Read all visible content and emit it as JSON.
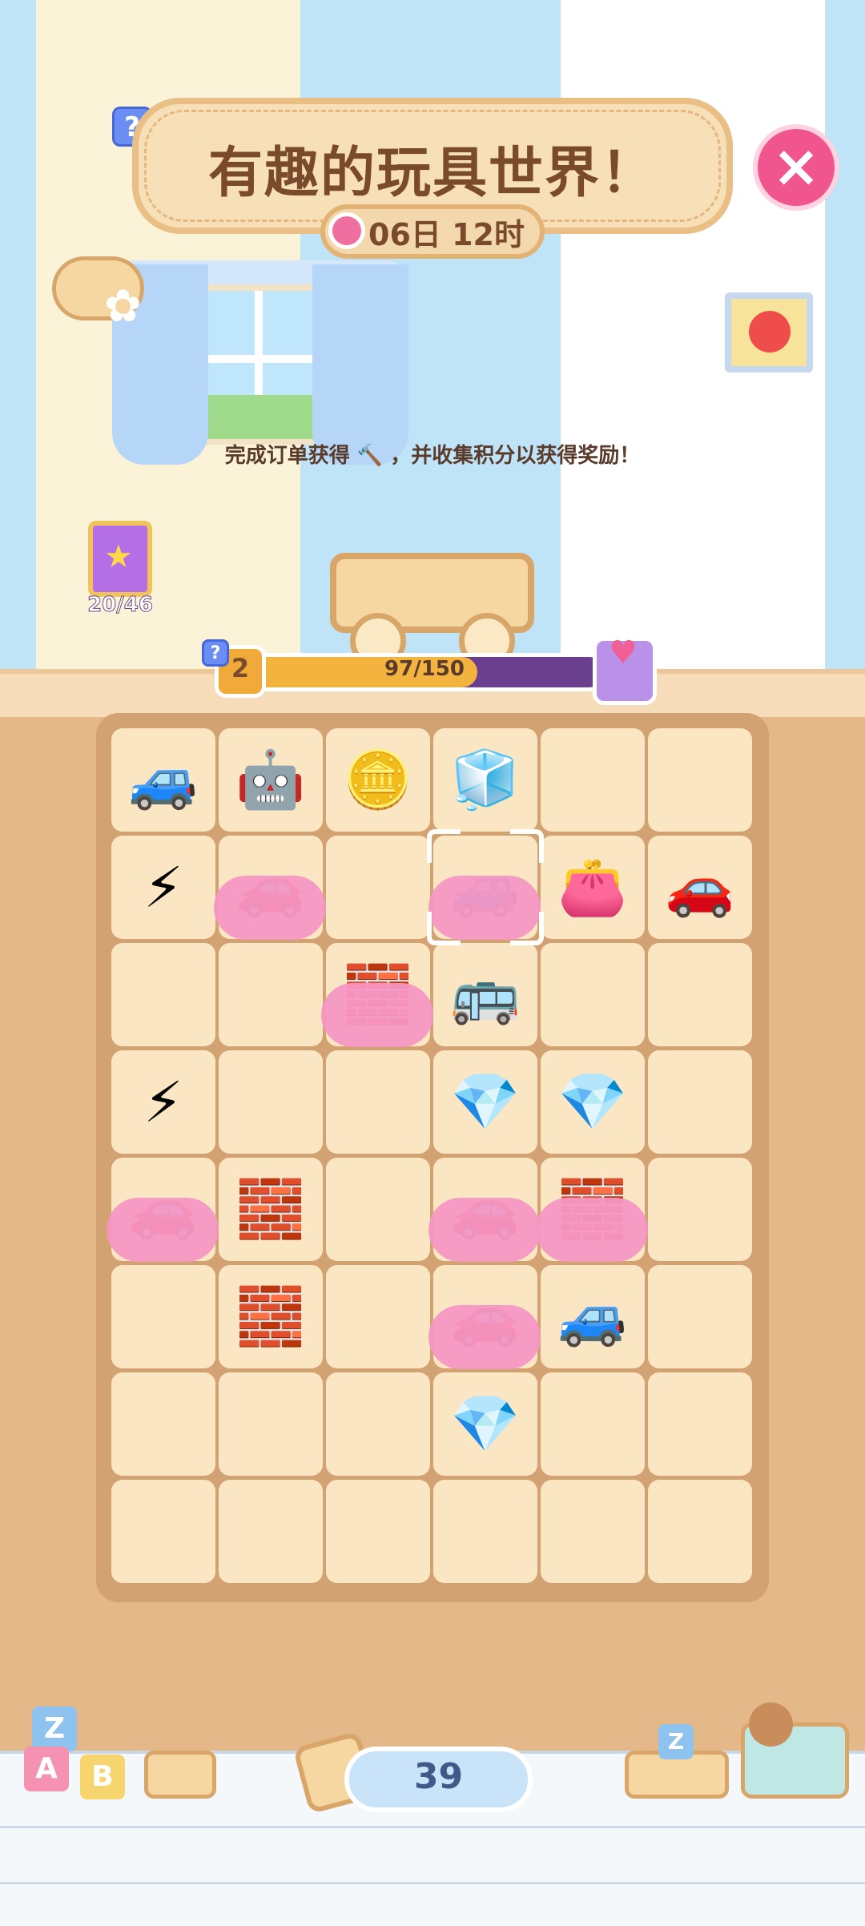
{
  "event": {
    "title": "有趣的玩具世界！",
    "timer": "06日 12时",
    "subtitle": "完成订单获得 🔨 ，并收集积分以获得奖励！"
  },
  "album": {
    "count": "20/46"
  },
  "progress": {
    "level": "2",
    "text": "97/150",
    "fraction": 0.6467
  },
  "board": {
    "rows": 8,
    "cols": 6,
    "items": [
      {
        "row": 0,
        "col": 0,
        "name": "blue-toy-car",
        "glyph": "🚙"
      },
      {
        "row": 0,
        "col": 1,
        "name": "robot-toy",
        "glyph": "🤖"
      },
      {
        "row": 0,
        "col": 2,
        "name": "purple-coins",
        "glyph": "🪙"
      },
      {
        "row": 0,
        "col": 3,
        "name": "shape-sorter-cube",
        "glyph": "🧊"
      },
      {
        "row": 1,
        "col": 0,
        "name": "lightning-energy",
        "glyph": "⚡"
      },
      {
        "row": 1,
        "col": 1,
        "name": "covered-green-car",
        "glyph": "🚗",
        "covered": true
      },
      {
        "row": 1,
        "col": 3,
        "name": "covered-blue-car",
        "glyph": "🚙",
        "covered": true,
        "selected": true
      },
      {
        "row": 1,
        "col": 4,
        "name": "purple-bow-purse",
        "glyph": "👛"
      },
      {
        "row": 1,
        "col": 5,
        "name": "green-toy-car",
        "glyph": "🚗"
      },
      {
        "row": 2,
        "col": 2,
        "name": "covered-blue-blocks",
        "glyph": "🧱",
        "covered": true
      },
      {
        "row": 2,
        "col": 3,
        "name": "green-toy-bus",
        "glyph": "🚌"
      },
      {
        "row": 3,
        "col": 0,
        "name": "lightning-bundle",
        "glyph": "⚡"
      },
      {
        "row": 3,
        "col": 3,
        "name": "pink-gems",
        "glyph": "💎"
      },
      {
        "row": 3,
        "col": 4,
        "name": "pink-gems",
        "glyph": "💎"
      },
      {
        "row": 4,
        "col": 0,
        "name": "covered-green-car",
        "glyph": "🚗",
        "covered": true
      },
      {
        "row": 4,
        "col": 1,
        "name": "building-blocks",
        "glyph": "🧱"
      },
      {
        "row": 4,
        "col": 3,
        "name": "covered-green-car",
        "glyph": "🚗",
        "covered": true
      },
      {
        "row": 4,
        "col": 4,
        "name": "covered-red-blocks",
        "glyph": "🧱",
        "covered": true
      },
      {
        "row": 5,
        "col": 1,
        "name": "purple-block-stack",
        "glyph": "🧱"
      },
      {
        "row": 5,
        "col": 3,
        "name": "covered-green-car",
        "glyph": "🚗",
        "covered": true
      },
      {
        "row": 5,
        "col": 4,
        "name": "teal-toy-car",
        "glyph": "🚙"
      },
      {
        "row": 6,
        "col": 3,
        "name": "pink-gem",
        "glyph": "💎"
      }
    ]
  },
  "bottom": {
    "hammer_count": "39",
    "blocks": [
      "Z",
      "A",
      "B"
    ],
    "truck_block": "Z"
  },
  "colors": {
    "accent": "#f0558e",
    "wall": "#bfe3f7",
    "cell": "#fbe6c4",
    "board": "#d3a272"
  }
}
